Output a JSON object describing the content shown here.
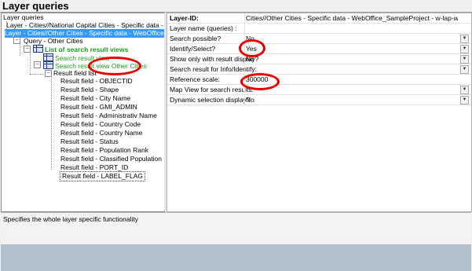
{
  "window_title": "Layer queries",
  "tree": {
    "root_label": "Layer queries",
    "layer_national": "Layer - Cities//National Capital Cities - Specific data - WebOffice_Samp",
    "layer_other": "Layer - Cities//Other Cities - Specific data - WebOffice_Sa",
    "query": "Query - Other Cities",
    "list_views": "List of search result views",
    "view1": "Search result view",
    "view2": "Search result view",
    "view2_suffix": "Other Cities",
    "field_list": "Result field list",
    "fields": [
      "Result field - OBJECTID",
      "Result field - Shape",
      "Result field - City Name",
      "Result field - GMI_ADMIN",
      "Result field - Administrativ Name",
      "Result field - Country Code",
      "Result field - Country Name",
      "Result field - Status",
      "Result field - Population Rank",
      "Result field - Classified Population Ran",
      "Result field - PORT_ID",
      "Result field - LABEL_FLAG"
    ]
  },
  "properties": [
    {
      "label": "Layer-ID:",
      "value": "Cities//Other Cities - Specific data - WebOffice_SampleProject - w-lap-weihs",
      "bold": true,
      "dropdown": false
    },
    {
      "label": "Layer name (queries) :",
      "value": "",
      "bold": false,
      "dropdown": false
    },
    {
      "label": "Search possible?",
      "value": "No",
      "bold": false,
      "dropdown": true
    },
    {
      "label": "Identify/Select?",
      "value": "Yes",
      "bold": false,
      "dropdown": true
    },
    {
      "label": "Show only with result display?",
      "value": "No",
      "bold": false,
      "dropdown": true
    },
    {
      "label": "Search result for Info/Identify:",
      "value": "",
      "bold": false,
      "dropdown": true
    },
    {
      "label": "Reference scale:",
      "value": "300000",
      "bold": false,
      "dropdown": false
    },
    {
      "label": "Map View for search results:",
      "value": "",
      "bold": false,
      "dropdown": true
    },
    {
      "label": "Dynamic selection display?",
      "value": "No",
      "bold": false,
      "dropdown": true
    }
  ],
  "description": "Specifies the whole layer specific functionality",
  "icons": {
    "expand": "expand-icon",
    "collapse": "collapse-icon",
    "table": "table-icon",
    "dropdown": "chevron-down-icon"
  },
  "highlight_color": "#e80000"
}
